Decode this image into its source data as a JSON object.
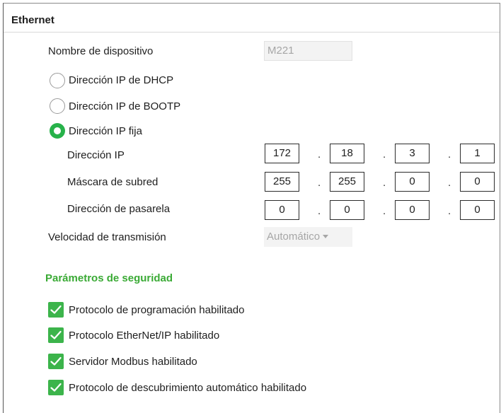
{
  "section": {
    "title": "Ethernet"
  },
  "device_name": {
    "label": "Nombre de dispositivo",
    "value": "M221"
  },
  "ip_mode": {
    "options": [
      {
        "label": "Dirección IP de DHCP",
        "checked": false
      },
      {
        "label": "Dirección IP de BOOTP",
        "checked": false
      },
      {
        "label": "Dirección IP fija",
        "checked": true
      }
    ]
  },
  "fixed_ip": {
    "ip_address": {
      "label": "Dirección IP",
      "octets": [
        "172",
        "18",
        "3",
        "1"
      ]
    },
    "subnet_mask": {
      "label": "Máscara de subred",
      "octets": [
        "255",
        "255",
        "0",
        "0"
      ]
    },
    "gateway": {
      "label": "Dirección de pasarela",
      "octets": [
        "0",
        "0",
        "0",
        "0"
      ]
    },
    "separator": "."
  },
  "speed": {
    "label": "Velocidad de transmisión",
    "value": "Automático"
  },
  "security": {
    "title": "Parámetros de seguridad",
    "items": [
      {
        "label": "Protocolo de programación habilitado",
        "checked": true
      },
      {
        "label": "Protocolo EtherNet/IP habilitado",
        "checked": true
      },
      {
        "label": "Servidor Modbus habilitado",
        "checked": true
      },
      {
        "label": "Protocolo de descubrimiento automático habilitado",
        "checked": true
      }
    ]
  },
  "colors": {
    "accent_green": "#3cb44b",
    "section_green": "#3aaa35",
    "radio_green": "#27b24a"
  }
}
